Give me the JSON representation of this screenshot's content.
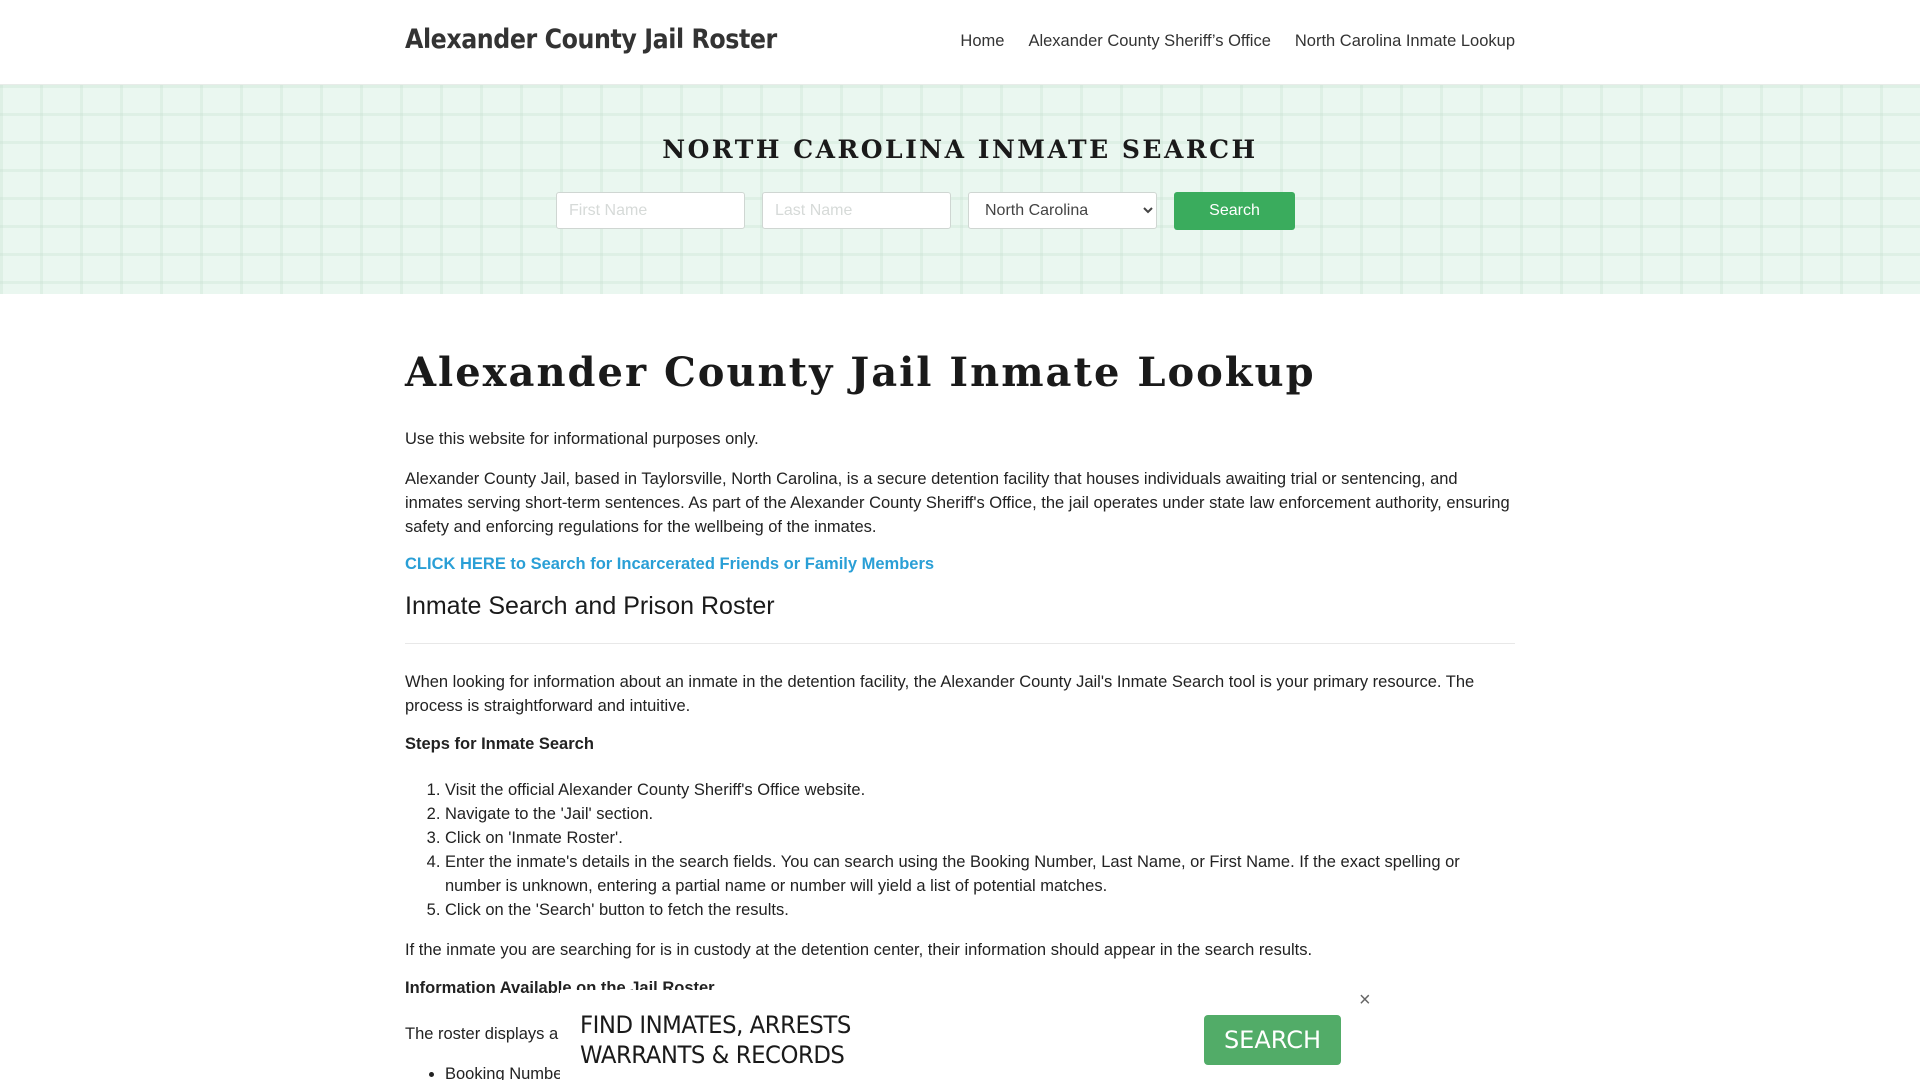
{
  "header": {
    "site_title": "Alexander County Jail Roster",
    "nav": [
      {
        "label": "Home"
      },
      {
        "label": "Alexander County Sheriff’s Office"
      },
      {
        "label": "North Carolina Inmate Lookup"
      }
    ]
  },
  "banner": {
    "title": "NORTH CAROLINA INMATE SEARCH",
    "first_name_placeholder": "First Name",
    "last_name_placeholder": "Last Name",
    "state_selected": "North Carolina",
    "search_label": "Search",
    "accent_color": "#3aac5d"
  },
  "content": {
    "title": "Alexander County Jail Inmate Lookup",
    "intro": "Use this website for informational purposes only.",
    "description": "Alexander County Jail, based in Taylorsville, North Carolina, is a secure detention facility that houses individuals awaiting trial or sentencing, and inmates serving short-term sentences. As part of the Alexander County Sheriff's Office, the jail operates under state law enforcement authority, ensuring safety and enforcing regulations for the wellbeing of the inmates.",
    "cta_link": "CLICK HERE to Search for Incarcerated Friends or Family Members",
    "section_title": "Inmate Search and Prison Roster",
    "section_intro": "When looking for information about an inmate in the detention facility, the Alexander County Jail's Inmate Search tool is your primary resource. The process is straightforward and intuitive.",
    "steps_title": "Steps for Inmate Search",
    "steps": [
      "Visit the official Alexander County Sheriff's Office website.",
      "Navigate to the 'Jail' section.",
      "Click on 'Inmate Roster'.",
      "Enter the inmate's details in the search fields. You can search using the Booking Number, Last Name, or First Name. If the exact spelling or number is unknown, entering a partial name or number will yield a list of potential matches.",
      "Click on the 'Search' button to fetch the results."
    ],
    "after_steps": "If the inmate you are searching for is in custody at the detention center, their information should appear in the search results.",
    "info_title": "Information Available on the Jail Roster",
    "info_intro": "The roster displays a w",
    "info_items": [
      "Booking Number"
    ]
  },
  "ad": {
    "line1": "FIND INMATES, ARRESTS",
    "line2": "WARRANTS & RECORDS",
    "button_label": "SEARCH",
    "close_icon": "×",
    "button_color": "#52ac68"
  }
}
